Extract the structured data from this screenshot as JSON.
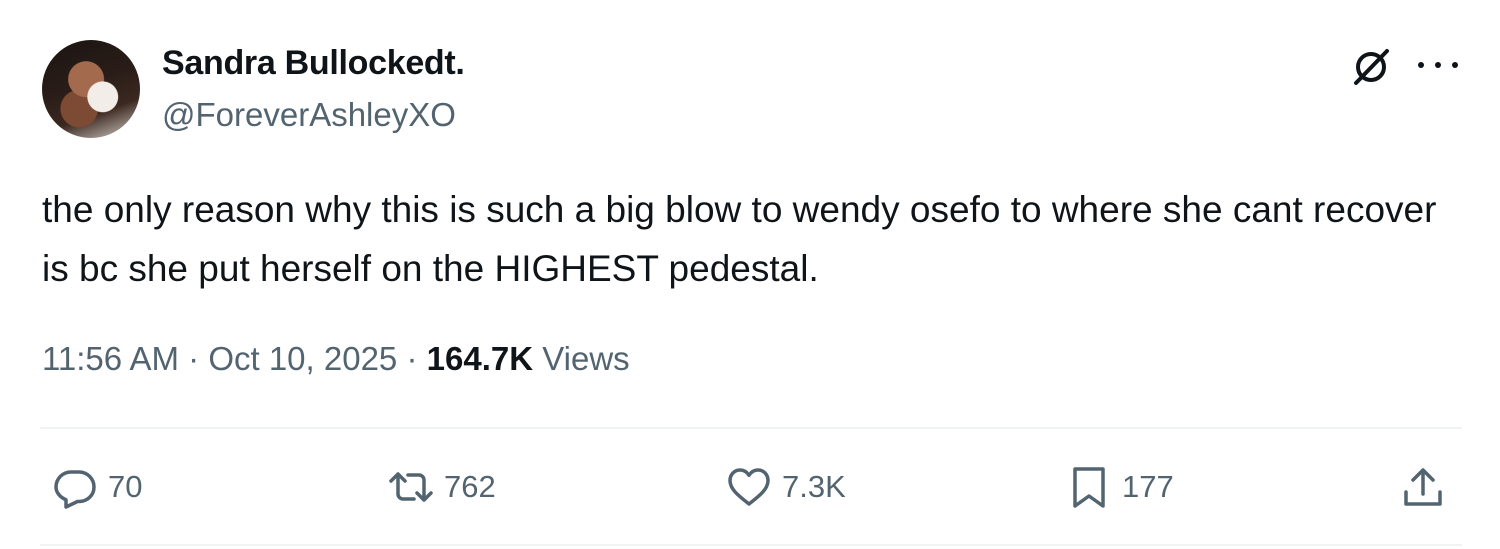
{
  "author": {
    "display_name": "Sandra Bullockedt.",
    "handle": "@ForeverAshleyXO"
  },
  "tweet": {
    "text": "the only reason why this is such a big blow to wendy osefo to where she cant recover is bc she put herself on the HIGHEST pedestal."
  },
  "meta": {
    "time": "11:56 AM",
    "separator": "·",
    "date": "Oct 10, 2025",
    "views_count": "164.7K",
    "views_label": "Views"
  },
  "actions": {
    "replies": "70",
    "reposts": "762",
    "likes": "7.3K",
    "bookmarks": "177"
  },
  "icons": {
    "grok": "grok-icon",
    "more": "more-icon",
    "reply": "reply-icon",
    "repost": "repost-icon",
    "like": "heart-icon",
    "bookmark": "bookmark-icon",
    "share": "share-icon"
  },
  "colors": {
    "text": "#0f1419",
    "secondary": "#536471",
    "divider": "#eff3f4"
  }
}
